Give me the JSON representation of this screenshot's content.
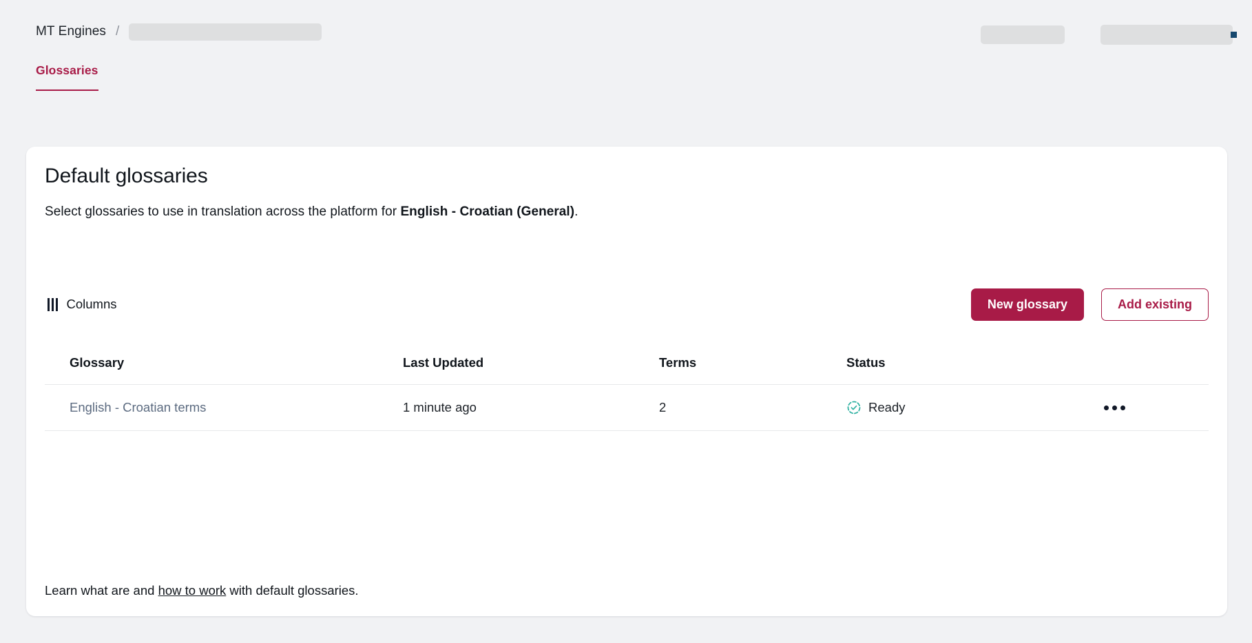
{
  "topbar": {
    "breadcrumb": {
      "root_label": "MT Engines",
      "separator": "/",
      "current_redacted": ""
    },
    "right_controls": [
      {
        "name": "redacted-control-1",
        "label": ""
      },
      {
        "name": "redacted-control-2",
        "label": ""
      }
    ]
  },
  "tabs": [
    {
      "label": "Glossaries",
      "active": true
    }
  ],
  "card": {
    "title": "Default glossaries",
    "subtitle_prefix": "Select glossaries to use in translation across the platform for ",
    "subtitle_strong": "English - Croatian (General)",
    "subtitle_suffix": ".",
    "toolbar": {
      "columns_label": "Columns",
      "new_glossary_label": "New glossary",
      "add_existing_label": "Add existing"
    },
    "table": {
      "columns": [
        "Glossary",
        "Last Updated",
        "Terms",
        "Status"
      ],
      "rows": [
        {
          "glossary": "English - Croatian terms",
          "last_updated": "1 minute ago",
          "terms": "2",
          "status": "Ready",
          "status_icon": "check-circle-dashed-icon"
        }
      ]
    },
    "footer": {
      "prefix": "Learn what are and ",
      "link": "how to work",
      "suffix": " with default glossaries."
    }
  },
  "colors": {
    "accent": "#a81b47",
    "page_background": "#f1f2f4",
    "card_background": "#ffffff",
    "status_ready": "#2cb0a0",
    "link_muted": "#5c6b80",
    "divider": "#e7e8ea"
  }
}
